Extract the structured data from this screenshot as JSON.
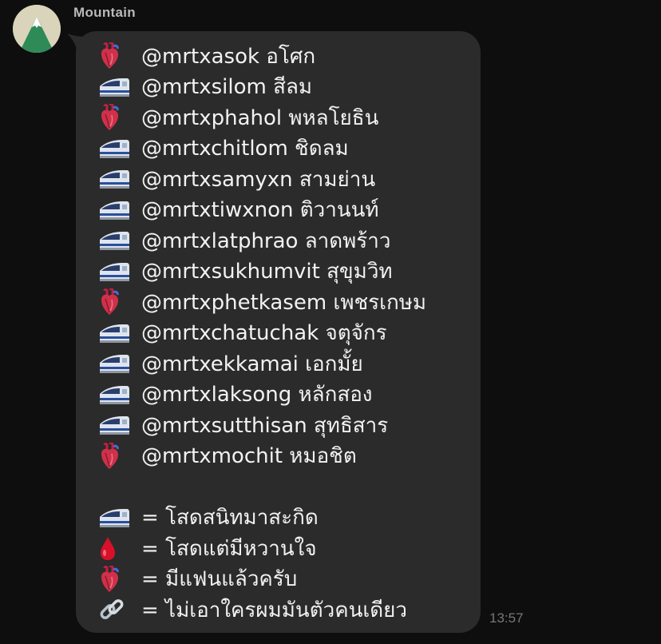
{
  "chat": {
    "sender_name": "Mountain",
    "timestamp": "13:57"
  },
  "message": {
    "lines": [
      {
        "icon": "anatomical-heart-icon",
        "text": "@mrtxasok อโศก"
      },
      {
        "icon": "train-icon",
        "text": "@mrtxsilom สีลม"
      },
      {
        "icon": "anatomical-heart-icon",
        "text": "@mrtxphahol พหลโยธิน"
      },
      {
        "icon": "train-icon",
        "text": "@mrtxchitlom ชิดลม"
      },
      {
        "icon": "train-icon",
        "text": "@mrtxsamyxn สามย่าน"
      },
      {
        "icon": "train-icon",
        "text": "@mrtxtiwxnon ติวานนท์"
      },
      {
        "icon": "train-icon",
        "text": "@mrtxlatphrao ลาดพร้าว"
      },
      {
        "icon": "train-icon",
        "text": "@mrtxsukhumvit สุขุมวิท"
      },
      {
        "icon": "anatomical-heart-icon",
        "text": "@mrtxphetkasem เพชรเกษม"
      },
      {
        "icon": "train-icon",
        "text": "@mrtxchatuchak จตุจักร"
      },
      {
        "icon": "train-icon",
        "text": "@mrtxekkamai เอกมั้ย"
      },
      {
        "icon": "train-icon",
        "text": "@mrtxlaksong หลักสอง"
      },
      {
        "icon": "train-icon",
        "text": "@mrtxsutthisan สุทธิสาร"
      },
      {
        "icon": "anatomical-heart-icon",
        "text": "@mrtxmochit หมอชิต"
      }
    ],
    "legend": [
      {
        "icon": "train-icon",
        "text": "= โสดสนิทมาสะกิด"
      },
      {
        "icon": "drop-of-blood-icon",
        "text": "= โสดแต่มีหวานใจ"
      },
      {
        "icon": "anatomical-heart-icon",
        "text": "= มีแฟนแล้วครับ"
      },
      {
        "icon": "link-icon",
        "text": "= ไม่เอาใครผมมันตัวคนเดียว"
      }
    ]
  },
  "colors": {
    "background": "#0e0e0e",
    "bubble": "#2b2b2b",
    "text": "#f2f2f2",
    "sender": "#b9b9b9",
    "timestamp": "#777777",
    "avatar_bg": "#d9d4ba",
    "avatar_mountain": "#2e8a57"
  }
}
